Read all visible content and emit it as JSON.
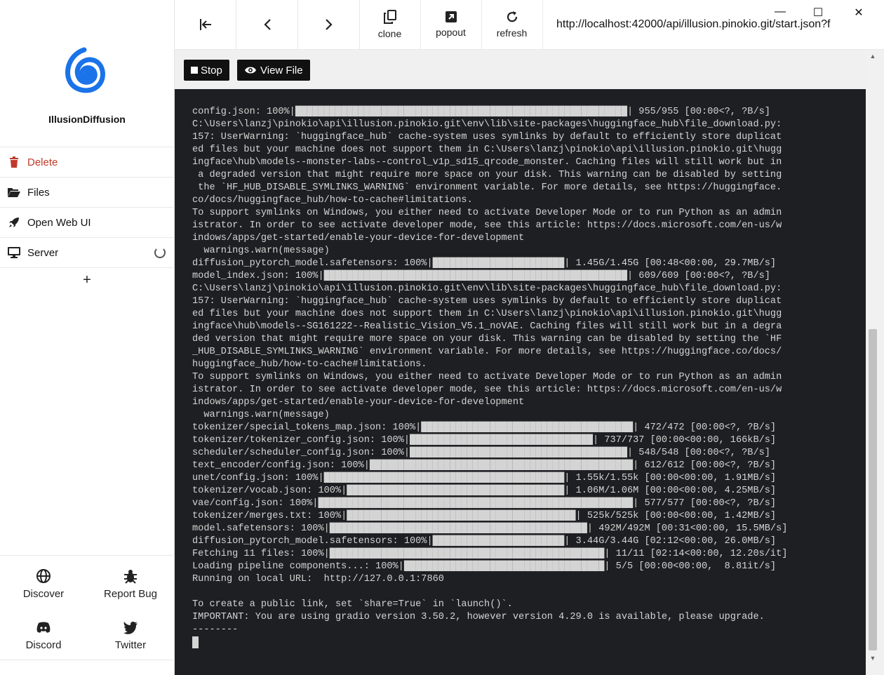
{
  "window": {
    "minimize": "—",
    "maximize": "☐",
    "close": "✕"
  },
  "app": {
    "name": "IllusionDiffusion"
  },
  "sidebar": {
    "items": [
      {
        "label": "Delete",
        "icon": "trash-icon"
      },
      {
        "label": "Files",
        "icon": "folder-open-icon"
      },
      {
        "label": "Open Web UI",
        "icon": "rocket-icon"
      },
      {
        "label": "Server",
        "icon": "desktop-icon"
      }
    ],
    "add_label": "+",
    "bottom": [
      {
        "label": "Discover",
        "icon": "globe-icon"
      },
      {
        "label": "Report Bug",
        "icon": "bug-icon"
      },
      {
        "label": "Discord",
        "icon": "discord-icon"
      },
      {
        "label": "Twitter",
        "icon": "twitter-icon"
      }
    ]
  },
  "toolbar": {
    "clone": "clone",
    "popout": "popout",
    "refresh": "refresh",
    "url": "http://localhost:42000/api/illusion.pinokio.git/start.json?f"
  },
  "actions": {
    "stop": "Stop",
    "view_file": "View File"
  },
  "terminal": {
    "lines": [
      "config.json: 100%|██████████████████████████████████████████████████████████| 955/955 [00:00<?, ?B/s]",
      "C:\\Users\\lanzj\\pinokio\\api\\illusion.pinokio.git\\env\\lib\\site-packages\\huggingface_hub\\file_download.py:",
      "157: UserWarning: `huggingface_hub` cache-system uses symlinks by default to efficiently store duplicat",
      "ed files but your machine does not support them in C:\\Users\\lanzj\\pinokio\\api\\illusion.pinokio.git\\hugg",
      "ingface\\hub\\models--monster-labs--control_v1p_sd15_qrcode_monster. Caching files will still work but in",
      " a degraded version that might require more space on your disk. This warning can be disabled by setting",
      " the `HF_HUB_DISABLE_SYMLINKS_WARNING` environment variable. For more details, see https://huggingface.",
      "co/docs/huggingface_hub/how-to-cache#limitations.",
      "To support symlinks on Windows, you either need to activate Developer Mode or to run Python as an admin",
      "istrator. In order to see activate developer mode, see this article: https://docs.microsoft.com/en-us/w",
      "indows/apps/get-started/enable-your-device-for-development",
      "  warnings.warn(message)",
      "diffusion_pytorch_model.safetensors: 100%|███████████████████████| 1.45G/1.45G [00:48<00:00, 29.7MB/s]",
      "model_index.json: 100%|█████████████████████████████████████████████████████| 609/609 [00:00<?, ?B/s]",
      "C:\\Users\\lanzj\\pinokio\\api\\illusion.pinokio.git\\env\\lib\\site-packages\\huggingface_hub\\file_download.py:",
      "157: UserWarning: `huggingface_hub` cache-system uses symlinks by default to efficiently store duplicat",
      "ed files but your machine does not support them in C:\\Users\\lanzj\\pinokio\\api\\illusion.pinokio.git\\hugg",
      "ingface\\hub\\models--SG161222--Realistic_Vision_V5.1_noVAE. Caching files will still work but in a degra",
      "ded version that might require more space on your disk. This warning can be disabled by setting the `HF",
      "_HUB_DISABLE_SYMLINKS_WARNING` environment variable. For more details, see https://huggingface.co/docs/",
      "huggingface_hub/how-to-cache#limitations.",
      "To support symlinks on Windows, you either need to activate Developer Mode or to run Python as an admin",
      "istrator. In order to see activate developer mode, see this article: https://docs.microsoft.com/en-us/w",
      "indows/apps/get-started/enable-your-device-for-development",
      "  warnings.warn(message)",
      "tokenizer/special_tokens_map.json: 100%|█████████████████████████████████████| 472/472 [00:00<?, ?B/s]",
      "tokenizer/tokenizer_config.json: 100%|████████████████████████████████| 737/737 [00:00<00:00, 166kB/s]",
      "scheduler/scheduler_config.json: 100%|██████████████████████████████████████| 548/548 [00:00<?, ?B/s]",
      "text_encoder/config.json: 100%|██████████████████████████████████████████████| 612/612 [00:00<?, ?B/s]",
      "unet/config.json: 100%|██████████████████████████████████████████| 1.55k/1.55k [00:00<00:00, 1.91MB/s]",
      "tokenizer/vocab.json: 100%|██████████████████████████████████████| 1.06M/1.06M [00:00<00:00, 4.25MB/s]",
      "vae/config.json: 100%|███████████████████████████████████████████████████████| 577/577 [00:00<?, ?B/s]",
      "tokenizer/merges.txt: 100%|████████████████████████████████████████| 525k/525k [00:00<00:00, 1.42MB/s]",
      "model.safetensors: 100%|█████████████████████████████████████████████| 492M/492M [00:31<00:00, 15.5MB/s]",
      "diffusion_pytorch_model.safetensors: 100%|███████████████████████| 3.44G/3.44G [02:12<00:00, 26.0MB/s]",
      "Fetching 11 files: 100%|████████████████████████████████████████████████| 11/11 [02:14<00:00, 12.20s/it]",
      "Loading pipeline components...: 100%|███████████████████████████████████| 5/5 [00:00<00:00,  8.81it/s]",
      "Running on local URL:  http://127.0.0.1:7860",
      "",
      "To create a public link, set `share=True` in `launch()`.",
      "IMPORTANT: You are using gradio version 3.50.2, however version 4.29.0 is available, please upgrade.",
      "--------"
    ]
  }
}
